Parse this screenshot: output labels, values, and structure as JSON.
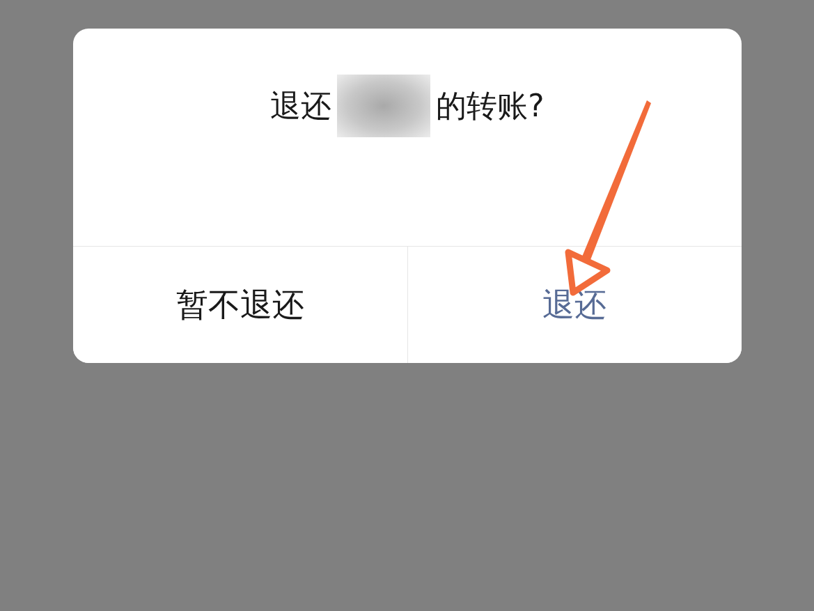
{
  "dialog": {
    "title_before": "退还",
    "title_redacted": true,
    "title_after": "的转账?",
    "buttons": [
      {
        "label": "暂不退还",
        "kind": "cancel"
      },
      {
        "label": "退还",
        "kind": "confirm"
      }
    ]
  }
}
